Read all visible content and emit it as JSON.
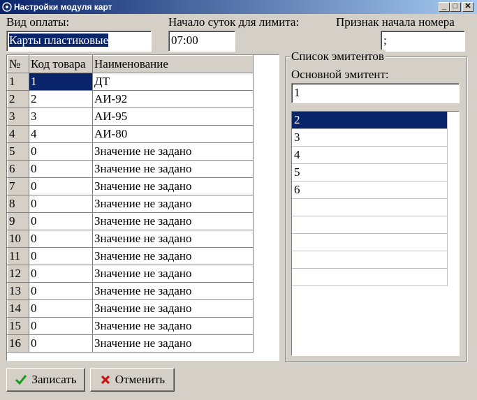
{
  "window": {
    "title": "Настройки модуля карт",
    "controls": {
      "minimize": "_",
      "maximize": "□",
      "close": "✕"
    }
  },
  "form": {
    "payment_type_label": "Вид оплаты:",
    "payment_type_value": "Карты пластиковые",
    "day_start_label": "Начало суток для лимита:",
    "day_start_value": "07:00",
    "number_sign_label": "Признак начала номера",
    "number_sign_value": ";"
  },
  "grid": {
    "columns": [
      "№",
      "Код товара",
      "Наименование"
    ],
    "rows": [
      [
        "1",
        "1",
        "ДТ"
      ],
      [
        "2",
        "2",
        "АИ-92"
      ],
      [
        "3",
        "3",
        "АИ-95"
      ],
      [
        "4",
        "4",
        "АИ-80"
      ],
      [
        "5",
        "0",
        "Значение не задано"
      ],
      [
        "6",
        "0",
        "Значение не задано"
      ],
      [
        "7",
        "0",
        "Значение не задано"
      ],
      [
        "8",
        "0",
        "Значение не задано"
      ],
      [
        "9",
        "0",
        "Значение не задано"
      ],
      [
        "10",
        "0",
        "Значение не задано"
      ],
      [
        "11",
        "0",
        "Значение не задано"
      ],
      [
        "12",
        "0",
        "Значение не задано"
      ],
      [
        "13",
        "0",
        "Значение не задано"
      ],
      [
        "14",
        "0",
        "Значение не задано"
      ],
      [
        "15",
        "0",
        "Значение не задано"
      ],
      [
        "16",
        "0",
        "Значение не задано"
      ]
    ]
  },
  "issuers": {
    "group_title": "Список эмитентов",
    "main_issuer_label": "Основной эмитент:",
    "main_issuer_value": "1",
    "items": [
      "2",
      "3",
      "4",
      "5",
      "6",
      "",
      "",
      "",
      "",
      ""
    ]
  },
  "buttons": {
    "save_label": "Записать",
    "cancel_label": "Отменить"
  },
  "colors": {
    "selection": "#0a246a",
    "save_icon": "#1a9a1a",
    "cancel_icon": "#c81414"
  }
}
